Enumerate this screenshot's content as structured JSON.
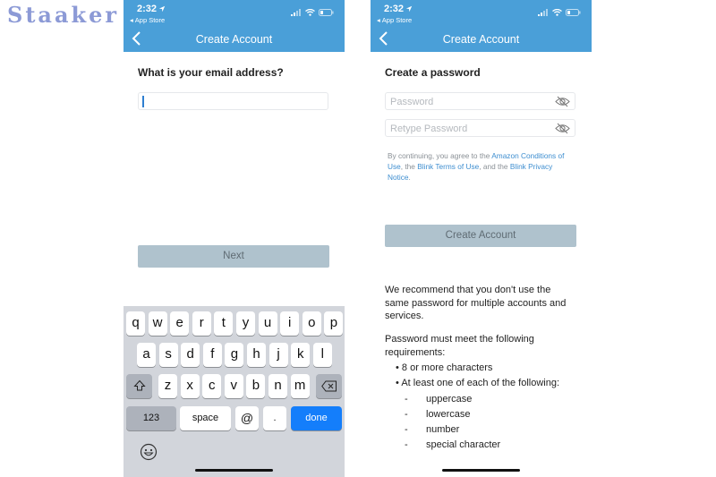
{
  "brand": {
    "name": "Staaker"
  },
  "colors": {
    "header": "#4a9fd8",
    "button_disabled": "#afc2cd",
    "link": "#3e8ed0",
    "key_done": "#147efb"
  },
  "left_screen": {
    "status": {
      "time": "2:32",
      "back_app": "App Store",
      "icons": [
        "location-arrow-icon",
        "signal-icon",
        "wifi-icon",
        "battery-icon"
      ]
    },
    "nav": {
      "back_icon": "chevron-left-icon",
      "title": "Create Account"
    },
    "question": "What is your email address?",
    "email_input": {
      "value": "",
      "placeholder": ""
    },
    "next_button": "Next",
    "keyboard": {
      "row1": [
        "q",
        "w",
        "e",
        "r",
        "t",
        "y",
        "u",
        "i",
        "o",
        "p"
      ],
      "row2": [
        "a",
        "s",
        "d",
        "f",
        "g",
        "h",
        "j",
        "k",
        "l"
      ],
      "row3": [
        "z",
        "x",
        "c",
        "v",
        "b",
        "n",
        "m"
      ],
      "shift_icon": "shift-icon",
      "delete_icon": "backspace-icon",
      "numbers": "123",
      "space": "space",
      "at": "@",
      "dot": ".",
      "done": "done",
      "emoji_icon": "emoji-icon"
    }
  },
  "right_screen": {
    "status": {
      "time": "2:32",
      "back_app": "App Store",
      "icons": [
        "location-arrow-icon",
        "signal-icon",
        "wifi-icon",
        "battery-icon"
      ]
    },
    "nav": {
      "back_icon": "chevron-left-icon",
      "title": "Create Account"
    },
    "title": "Create a password",
    "password_input": {
      "value": "",
      "placeholder": "Password",
      "toggle_icon": "eye-slash-icon"
    },
    "retype_input": {
      "value": "",
      "placeholder": "Retype Password",
      "toggle_icon": "eye-slash-icon"
    },
    "legal": {
      "prefix": "By continuing, you agree to the ",
      "link1": "Amazon Conditions of Use",
      "mid1": ", the ",
      "link2": "Blink Terms of Use",
      "mid2": ", and the ",
      "link3": "Blink Privacy Notice",
      "suffix": "."
    },
    "create_button": "Create Account",
    "recommendation": "We recommend that you don't use the same password for multiple accounts and services.",
    "requirements_intro": "Password must meet the following requirements:",
    "requirements": [
      "8 or more characters",
      "At least one of each of the following:"
    ],
    "sub_requirements": [
      "uppercase",
      "lowercase",
      "number",
      "special character"
    ]
  }
}
